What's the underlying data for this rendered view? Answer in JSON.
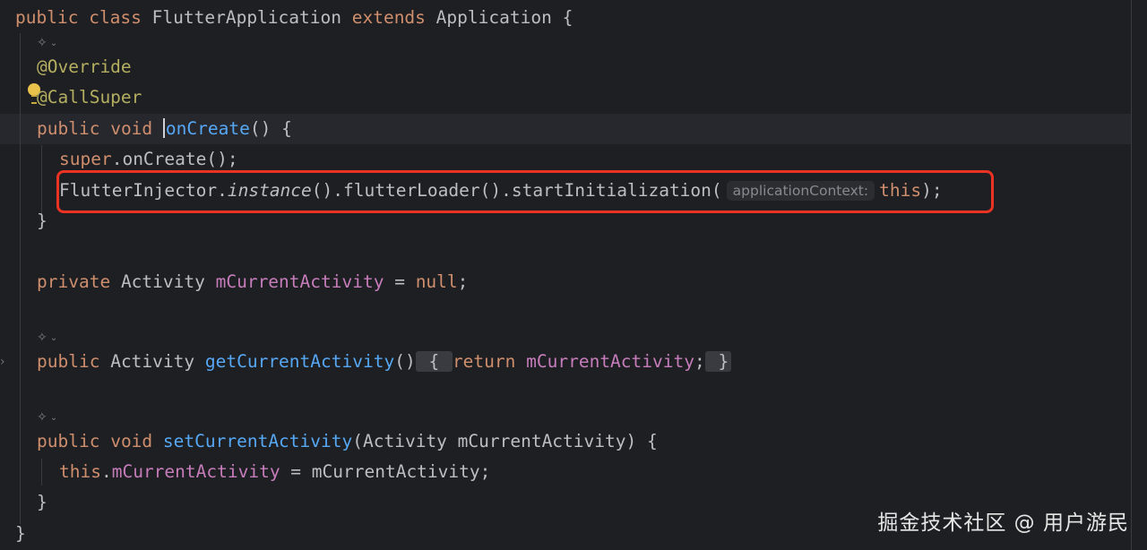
{
  "code": {
    "line_class_decl": {
      "kw1": "public",
      "kw2": "class",
      "name": "FlutterApplication",
      "kw3": "extends",
      "parent": "Application",
      "brace": "{"
    },
    "ann_override": "@Override",
    "ann_callsuper": "@CallSuper",
    "oncreate_decl": {
      "kw1": "public",
      "kw2": "void",
      "name": "onCreate",
      "rest": "() {"
    },
    "super_call": {
      "kw": "super",
      "dot": ".",
      "method": "onCreate",
      "rest": "();"
    },
    "init_call": {
      "cls": "FlutterInjector",
      "dot1": ".",
      "instance": "instance",
      "mid": "().flutterLoader().startInitialization(",
      "hint": "applicationContext:",
      "arg": "this",
      "end": ");"
    },
    "close_brace": "}",
    "field_decl": {
      "kw": "private",
      "type": "Activity",
      "name": "mCurrentActivity",
      "eq": " = ",
      "value": "null",
      "semi": ";"
    },
    "getter_decl": {
      "kw": "public",
      "type": "Activity",
      "name": "getCurrentActivity",
      "parens": "()",
      "open": "{",
      "ret": "return",
      "field": "mCurrentActivity",
      "semi": ";",
      "close": "}"
    },
    "setter_decl": {
      "kw1": "public",
      "kw2": "void",
      "name": "setCurrentActivity",
      "params": "(Activity mCurrentActivity) {"
    },
    "setter_body": {
      "kw": "this",
      "dot": ".",
      "field": "mCurrentActivity",
      "rest": " = mCurrentActivity;"
    },
    "class_close": "}"
  },
  "icons": {
    "ai_gutter": "ai-sparkle-icon",
    "bulb": "lightbulb-icon",
    "fold": "fold-arrow-icon"
  },
  "watermark": "掘金技术社区 @ 用户游民",
  "colors": {
    "background": "#1e1f22",
    "keyword": "#cf8e6d",
    "function": "#56a8f5",
    "field": "#c77dbb",
    "annotation": "#b3ae60",
    "highlight_box": "#ea3323"
  }
}
